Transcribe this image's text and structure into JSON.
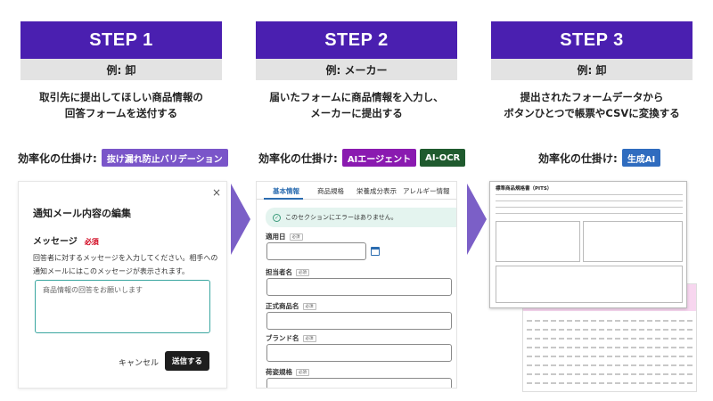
{
  "steps": [
    {
      "title": "STEP 1",
      "example": "例: 卸",
      "desc_lines": [
        "取引先に提出してほしい商品情報の",
        "回答フォームを送付する"
      ],
      "mechanism_label": "効率化の仕掛け:",
      "tags": [
        {
          "text": "抜け漏れ防止バリデーション",
          "color": "#7a55c9"
        }
      ]
    },
    {
      "title": "STEP 2",
      "example": "例: メーカー",
      "desc_lines": [
        "届いたフォームに商品情報を入力し、",
        "メーカーに提出する"
      ],
      "mechanism_label": "効率化の仕掛け:",
      "tags": [
        {
          "text": "AIエージェント",
          "color": "#8a1ab0"
        },
        {
          "text": "AI-OCR",
          "color": "#1f5a2e"
        }
      ]
    },
    {
      "title": "STEP 3",
      "example": "例: 卸",
      "desc_lines": [
        "提出されたフォームデータから",
        "ボタンひとつで帳票やCSVに変換する"
      ],
      "mechanism_label": "効率化の仕掛け:",
      "tags": [
        {
          "text": "生成AI",
          "color": "#2f6cbf"
        }
      ]
    }
  ],
  "dialog": {
    "close": "×",
    "title": "通知メール内容の編集",
    "message_label": "メッセージ",
    "required": "必須",
    "help_text": "回答者に対するメッセージを入力してください。相手への通知メールにはこのメッセージが表示されます。",
    "textarea_value": "商品情報の回答をお願いします",
    "cancel": "キャンセル",
    "send": "送信する"
  },
  "form": {
    "tabs": [
      "基本情報",
      "商品規格",
      "栄養成分表示",
      "アレルギー情報"
    ],
    "banner": "このセクションにエラーはありません。",
    "fields": [
      "適用日",
      "担当者名",
      "正式商品名",
      "ブランド名",
      "荷姿規格"
    ],
    "field_tag": "必須"
  },
  "document": {
    "title": "標準商品規格書（PITS）"
  },
  "colors": {
    "step_header": "#4a1fb0",
    "arrow": "#7b5fc7"
  }
}
